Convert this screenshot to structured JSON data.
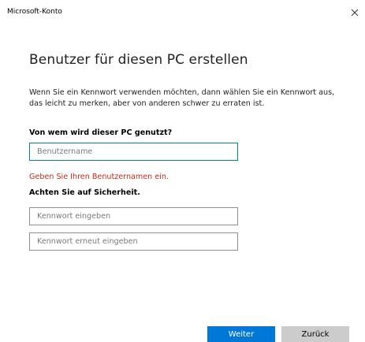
{
  "window": {
    "title": "Microsoft-Konto"
  },
  "page": {
    "heading": "Benutzer für diesen PC erstellen",
    "description": "Wenn Sie ein Kennwort verwenden möchten, dann wählen Sie ein Kennwort aus, das leicht zu merken, aber von anderen schwer zu erraten ist."
  },
  "user_section": {
    "label": "Von wem wird dieser PC genutzt?",
    "username_placeholder": "Benutzername",
    "username_value": "",
    "error": "Geben Sie Ihren Benutzernamen ein."
  },
  "security_section": {
    "label": "Achten Sie auf Sicherheit.",
    "password_placeholder": "Kennwort eingeben",
    "password_confirm_placeholder": "Kennwort erneut eingeben"
  },
  "buttons": {
    "next_label": "Weiter",
    "back_label": "Zurück"
  },
  "icons": {
    "close": "close-icon"
  },
  "colors": {
    "accent": "#0078d7",
    "error": "#c42b1c",
    "secondary_button": "#cccccc"
  }
}
